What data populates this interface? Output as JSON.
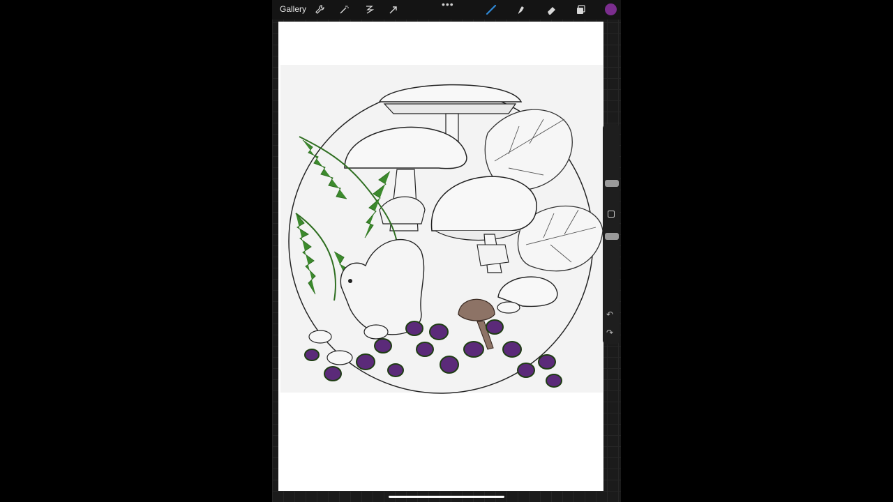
{
  "topbar": {
    "gallery_label": "Gallery",
    "more_label": "•••",
    "tools_left": [
      "wrench-icon",
      "magic-wand-icon",
      "selection-icon",
      "transform-arrow-icon"
    ],
    "tools_right": [
      "brush-icon",
      "smudge-icon",
      "eraser-icon",
      "layers-icon"
    ],
    "active_color": "#7b2d8e"
  },
  "sidebar": {
    "undo_label": "↶",
    "redo_label": "↷"
  },
  "artwork": {
    "fern_color": "#3c8a2d",
    "berry_color": "#5b2a79",
    "mushroom_accent": "#8d7366"
  }
}
